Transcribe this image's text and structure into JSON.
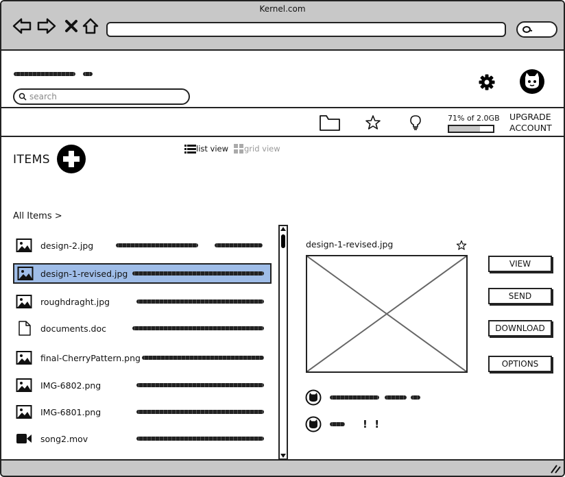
{
  "window": {
    "title": "Kernel.com"
  },
  "header": {
    "search_placeholder": "search"
  },
  "toolbar": {
    "quota_text": "71% of 2.0GB",
    "quota_fraction": 0.71,
    "upgrade_line1": "UPGRADE",
    "upgrade_line2": "ACCOUNT"
  },
  "items": {
    "title": "ITEMS",
    "list_view_label": "list view",
    "grid_view_label": "grid view",
    "breadcrumb": "All Items >",
    "files": [
      {
        "name": "design-2.jpg",
        "icon": "image-icon",
        "selected": false
      },
      {
        "name": "design-1-revised.jpg",
        "icon": "image-icon",
        "selected": true
      },
      {
        "name": "roughdraght.jpg",
        "icon": "image-icon",
        "selected": false
      },
      {
        "name": "documents.doc",
        "icon": "document-icon",
        "selected": false
      },
      {
        "name": "final-CherryPattern.png",
        "icon": "image-icon",
        "selected": false
      },
      {
        "name": "IMG-6802.png",
        "icon": "image-icon",
        "selected": false
      },
      {
        "name": "IMG-6801.png",
        "icon": "image-icon",
        "selected": false
      },
      {
        "name": "song2.mov",
        "icon": "video-icon",
        "selected": false
      }
    ]
  },
  "preview": {
    "title": "design-1-revised.jpg",
    "buttons": {
      "view": "VIEW",
      "send": "SEND",
      "download": "DOWNLOAD",
      "options": "OPTIONS"
    },
    "comment_marks": "!  !"
  },
  "colors": {
    "chrome": "#c8c8c8",
    "selection": "#9fbde8",
    "stroke": "#222222"
  }
}
